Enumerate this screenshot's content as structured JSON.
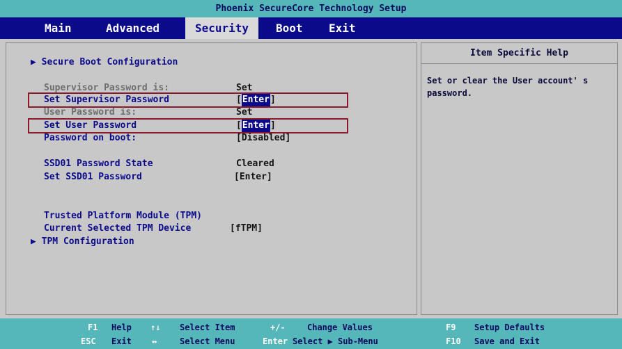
{
  "title": "Phoenix SecureCore Technology Setup",
  "menu": [
    "Main",
    "Advanced",
    "Security",
    "Boot",
    "Exit"
  ],
  "main": {
    "secure_boot": "▶ Secure Boot Configuration",
    "supervisor_status_label": "Supervisor Password is:",
    "supervisor_status_value": "Set",
    "set_supervisor_label": "Set Supervisor Password",
    "user_status_label": "User Password is:",
    "user_status_value": "Set",
    "set_user_label": "Set User Password",
    "enter_bracket_open": "[",
    "enter_highlight": "Enter",
    "enter_bracket_close": "]",
    "password_on_boot_label": "Password on boot:",
    "password_on_boot_value": "[Disabled]",
    "ssd_state_label": "SSD01 Password State",
    "ssd_state_value": "Cleared",
    "set_ssd_label": "Set SSD01 Password",
    "set_ssd_value": "[Enter]",
    "tpm_label": "Trusted Platform Module (TPM)",
    "tpm_device_label": "Current Selected TPM Device",
    "tpm_device_value": "[fTPM]",
    "tpm_config": "▶ TPM Configuration"
  },
  "help": {
    "title": "Item Specific Help",
    "text": "Set or clear the User account' s password."
  },
  "status": {
    "f1": "F1",
    "help": "Help",
    "arrows_ud": "↑↓",
    "select_item": "Select Item",
    "plusminus": "+/-",
    "change_values": "Change Values",
    "f9": "F9",
    "setup_defaults": "Setup Defaults",
    "esc": "ESC",
    "exit": "Exit",
    "arrows_lr": "↔",
    "select_menu": "Select Menu",
    "enter": "Enter",
    "select_submenu": "Select ▶ Sub-Menu",
    "f10": "F10",
    "save_exit": "Save and Exit"
  }
}
